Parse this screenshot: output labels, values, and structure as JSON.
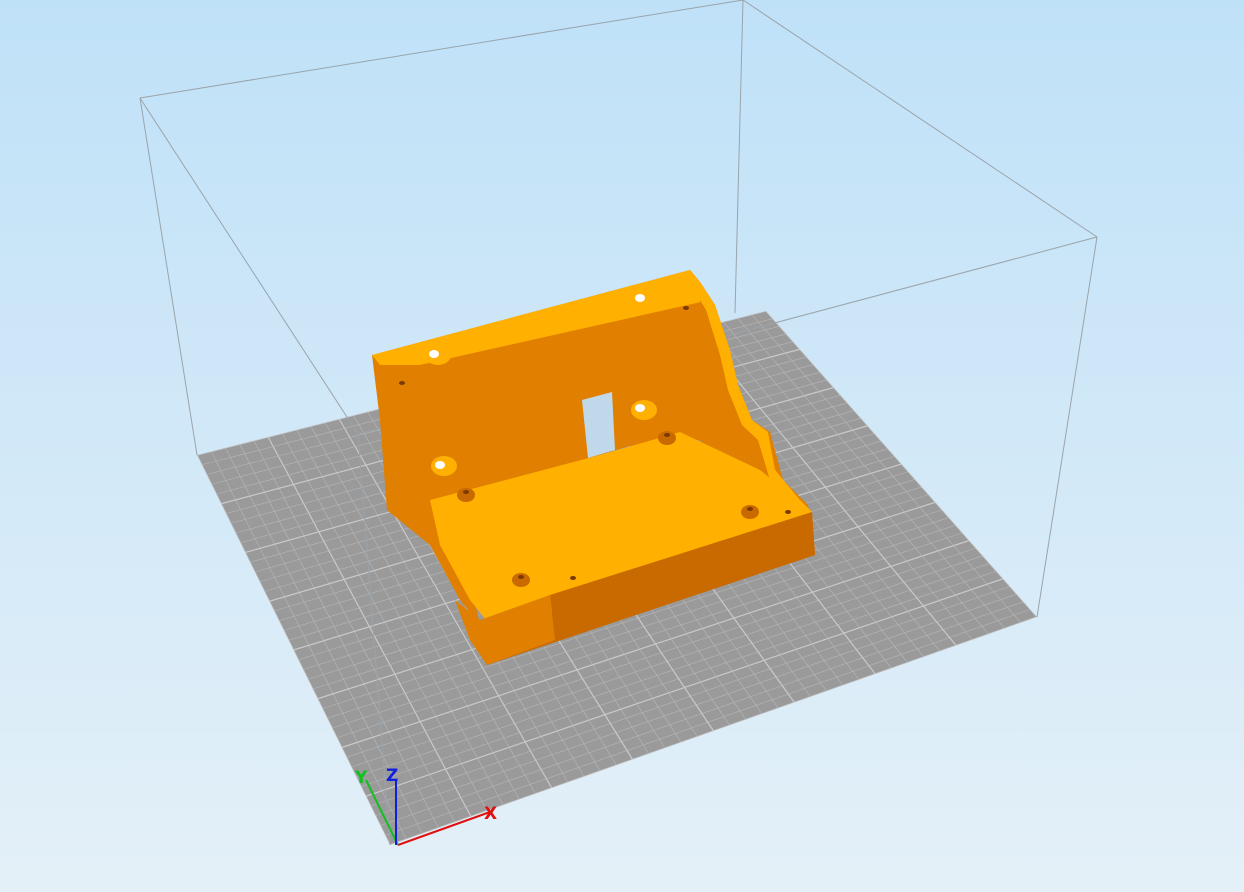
{
  "viewport": {
    "background_top": "#bfe1f8",
    "background_bottom": "#e4f0f8"
  },
  "build_plate": {
    "color": "#9a9a9a",
    "grid_color": "#b8b8b8",
    "major_grid_color": "#c9c9c9"
  },
  "build_volume": {
    "edge_color": "#9aa4ab"
  },
  "model": {
    "color_top": "#ffb000",
    "color_side": "#e07f00",
    "color_dark": "#c86a00"
  },
  "axes": {
    "x": {
      "label": "X",
      "color": "#e01010"
    },
    "y": {
      "label": "Y",
      "color": "#10c020"
    },
    "z": {
      "label": "Z",
      "color": "#1020e0"
    }
  }
}
